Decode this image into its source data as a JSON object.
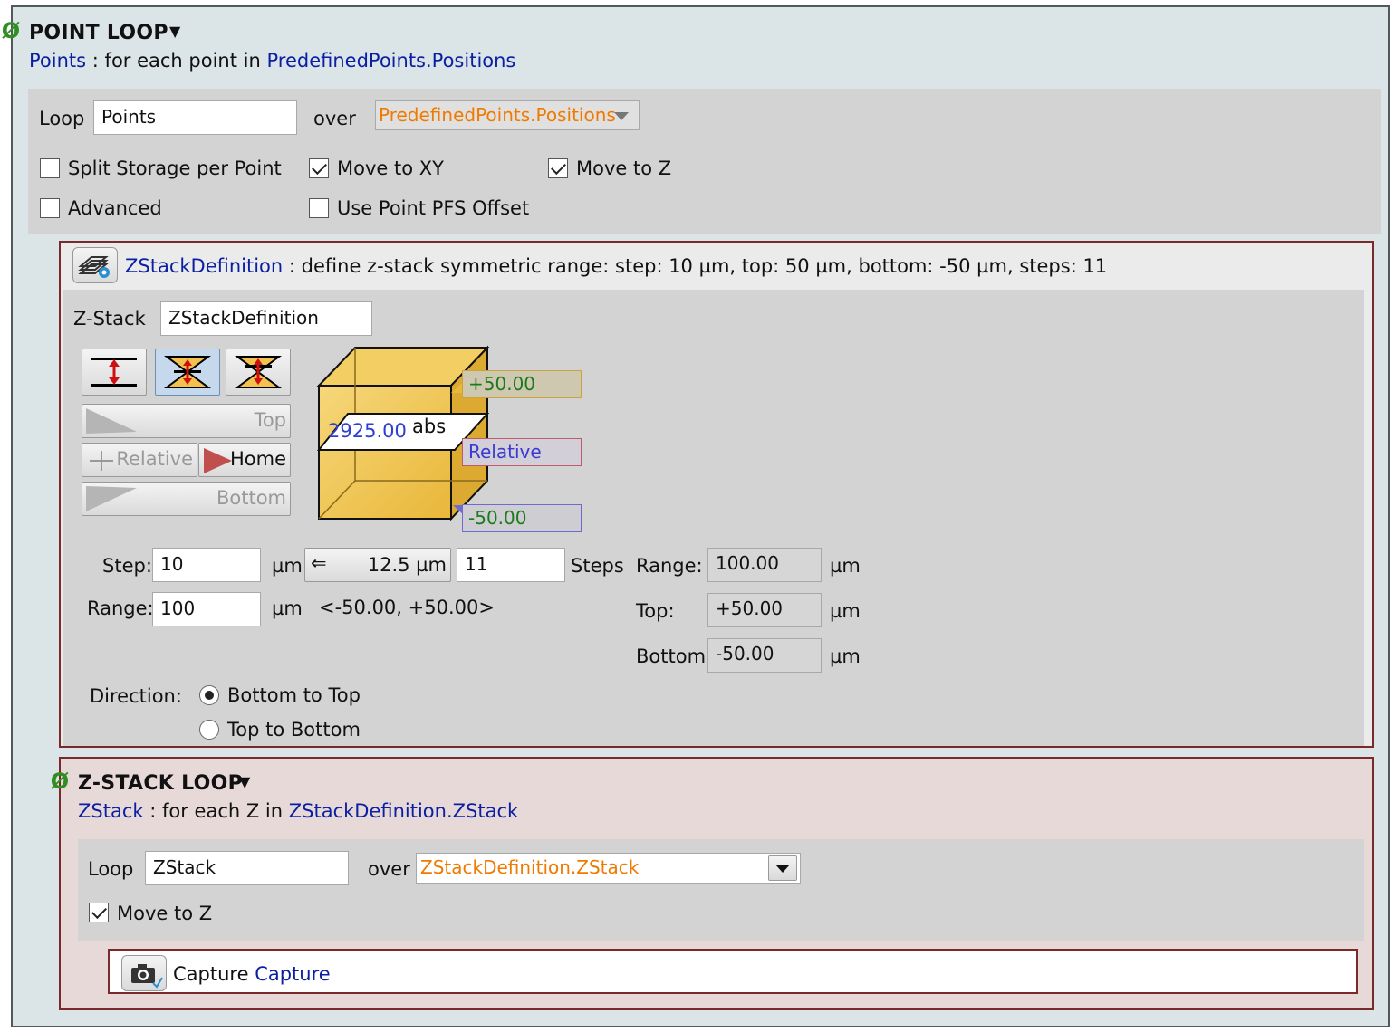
{
  "point_loop": {
    "title": "POINT LOOP",
    "caret": "▼",
    "summary_var": "Points",
    "summary_sep": ":",
    "summary_text": "for each point in",
    "summary_src": "PredefinedPoints.Positions",
    "loop_label": "Loop",
    "loop_value": "Points",
    "over_label": "over",
    "over_value": "PredefinedPoints.Positions",
    "options": {
      "split_storage": {
        "label": "Split Storage per Point",
        "checked": false
      },
      "move_xy": {
        "label": "Move to XY",
        "checked": true
      },
      "move_z": {
        "label": "Move to Z",
        "checked": true
      },
      "advanced": {
        "label": "Advanced",
        "checked": false
      },
      "pfs_offset": {
        "label": "Use Point PFS Offset",
        "checked": false
      }
    }
  },
  "zstack_def": {
    "name": "ZStackDefinition",
    "sep": ":",
    "summary": "define z-stack symmetric range: step: 10 µm, top: 50 µm, bottom: -50 µm, steps: 11",
    "zstack_label": "Z-Stack",
    "zstack_value": "ZStackDefinition",
    "buttons": {
      "top": "Top",
      "relative": "Relative",
      "home": "Home",
      "bottom": "Bottom"
    },
    "diagram": {
      "top_value": "+50.00",
      "current_value": "2925.00",
      "abs_label": "abs",
      "relative_label": "Relative",
      "bottom_value": "-50.00"
    },
    "step_label": "Step:",
    "step_value": "10",
    "step_unit": "µm",
    "calc_arrow": "⇐",
    "calc_value": "12.5 µm",
    "steps_value": "11",
    "steps_label": "Steps",
    "range_label": "Range:",
    "range_value": "100",
    "range_unit": "µm",
    "range_interval": "<-50.00, +50.00>",
    "right_range_label": "Range:",
    "right_range_value": "100.00",
    "top_label": "Top:",
    "top_value": "+50.00",
    "bottom_label": "Bottom:",
    "bottom_value": "-50.00",
    "unit": "µm",
    "direction_label": "Direction:",
    "direction_options": [
      "Bottom to Top",
      "Top to Bottom"
    ],
    "direction_selected": "Bottom to Top"
  },
  "zstack_loop": {
    "title": "Z-STACK LOOP",
    "caret": "▼",
    "summary_var": "ZStack",
    "summary_sep": ":",
    "summary_text": "for each Z in",
    "summary_src": "ZStackDefinition.ZStack",
    "loop_label": "Loop",
    "loop_value": "ZStack",
    "over_label": "over",
    "over_value": "ZStackDefinition.ZStack",
    "move_z": {
      "label": "Move to Z",
      "checked": true
    }
  },
  "capture": {
    "label": "Capture",
    "name": "Capture"
  },
  "colors": {
    "accent_blue": "#0b1fa3",
    "orange": "#f07a00",
    "green": "#2f8f22",
    "frame_red": "#7a2a2a"
  }
}
